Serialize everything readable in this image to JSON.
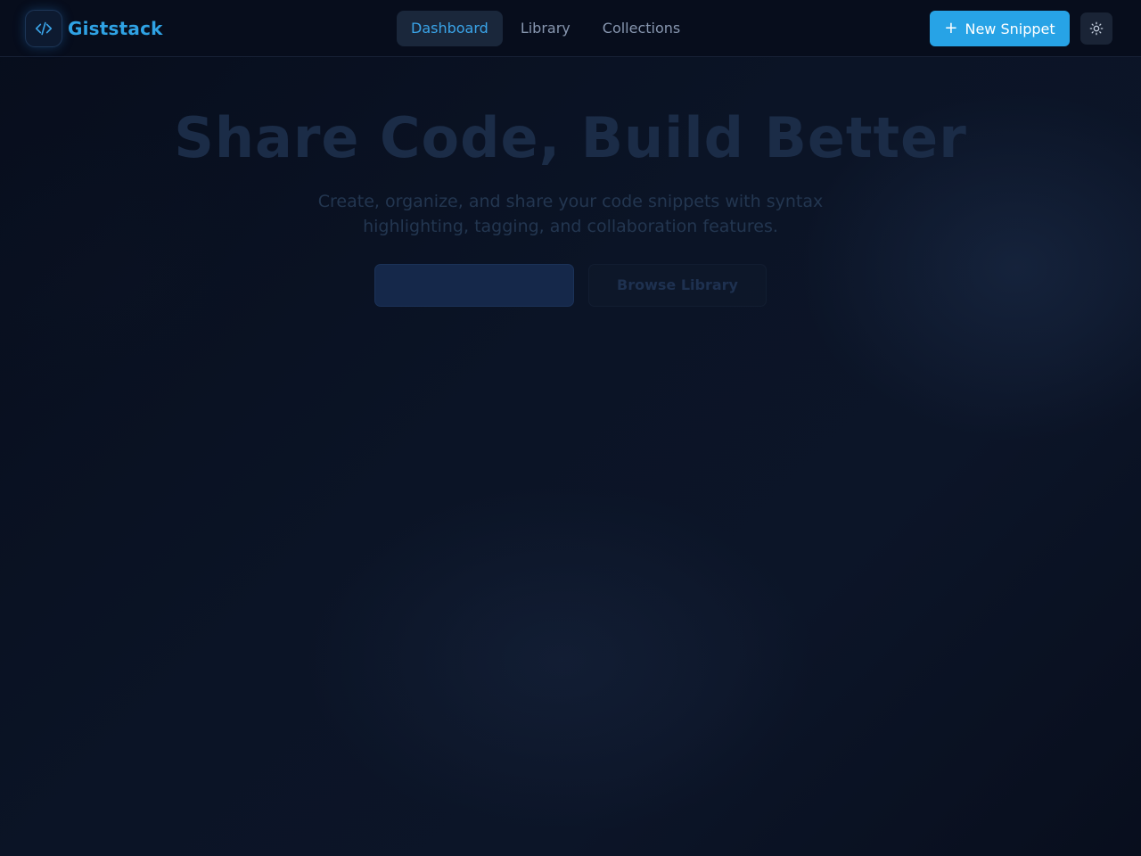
{
  "app": {
    "name": "Giststack"
  },
  "header": {
    "nav": [
      {
        "label": "Dashboard",
        "active": true
      },
      {
        "label": "Library",
        "active": false
      },
      {
        "label": "Collections",
        "active": false
      }
    ],
    "new_snippet_label": "New Snippet",
    "new_snippet_icon": "plus-icon",
    "theme_toggle_icon": "sun-icon"
  },
  "hero": {
    "title": "Share Code, Build Better",
    "subtitle": "Create, organize, and share your code snippets with syntax highlighting, tagging, and collaboration features.",
    "primary_button_label": "",
    "secondary_button_label": "Browse Library"
  },
  "colors": {
    "accent": "#27a3e6",
    "brand_text": "#2fa2e4",
    "background": "#0a1120",
    "header_background": "#070d1c"
  }
}
